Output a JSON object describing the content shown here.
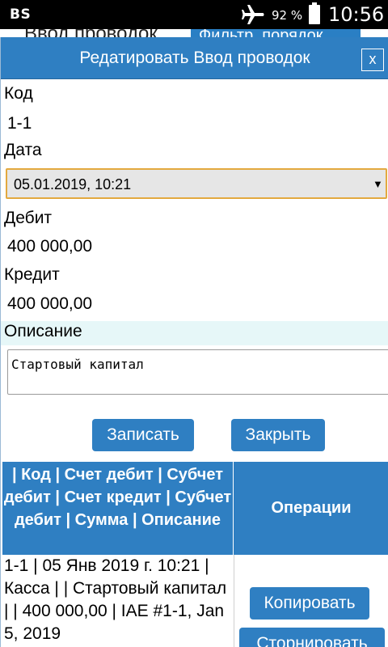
{
  "status_bar": {
    "carrier": "BS",
    "battery_percent": "92 %",
    "time": "10:56",
    "icons": [
      "airplane-mode-icon",
      "battery-icon"
    ]
  },
  "background_page": {
    "title": "Ввод проводок",
    "filter_button": "Фильтр, порядок"
  },
  "dialog": {
    "title": "Редатировать Ввод проводок",
    "close_label": "x",
    "fields": {
      "code_label": "Код",
      "code_value": "1-1",
      "date_label": "Дата",
      "date_value": "05.01.2019, 10:21",
      "date_arrow": "▼",
      "debit_label": "Дебит",
      "debit_value": "400 000,00",
      "credit_label": "Кредит",
      "credit_value": "400 000,00",
      "description_label": "Описание",
      "description_value": "Стартовый капитал"
    },
    "buttons": {
      "save": "Записать",
      "close": "Закрыть"
    },
    "table": {
      "header_main": "| Код | Счет дебит | Субчет дебит | Счет кредит | Субчет дебит | Сумма | Описание",
      "header_ops": "Операции",
      "rows": [
        {
          "text": "1-1 | 05 Янв 2019 г. 10:21 | Касса | | Стартовый капитал | | 400 000,00 | IAE #1-1, Jan 5, 2019",
          "copy_button": "Копировать",
          "storno_button": "Сторнировать"
        }
      ]
    }
  },
  "colors": {
    "accent": "#2f7fc2",
    "select_border": "#e3a93f",
    "description_band": "#e6f7f8"
  }
}
